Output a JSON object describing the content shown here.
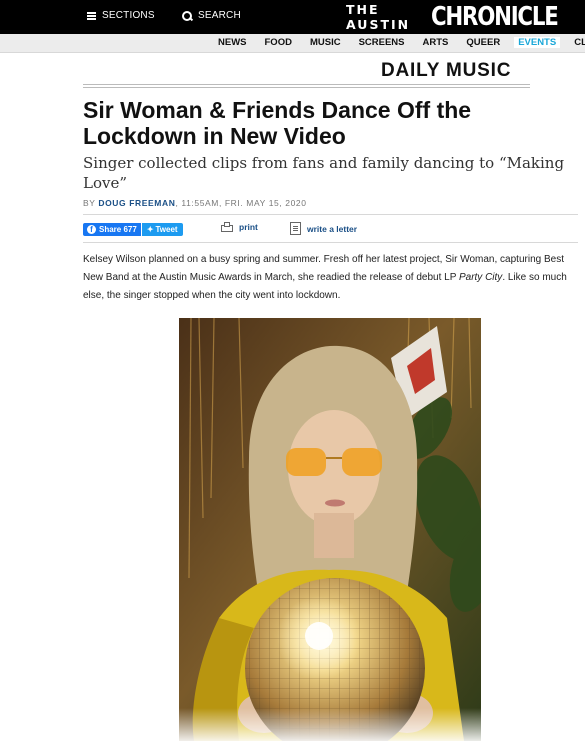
{
  "header": {
    "sections_label": "SECTIONS",
    "search_label": "SEARCH",
    "logo_the": "THE AUSTIN",
    "logo_chronicle": "CHRONICLE"
  },
  "nav": {
    "items": [
      "NEWS",
      "FOOD",
      "MUSIC",
      "SCREENS",
      "ARTS",
      "QUEER",
      "EVENTS",
      "CLASS"
    ],
    "active": "EVENTS",
    "active_color": "#1aa7d8"
  },
  "article": {
    "section": "DAILY MUSIC",
    "headline": "Sir Woman & Friends Dance Off the Lockdown in New Video",
    "dek": "Singer collected clips from fans and family dancing to “Making Love”",
    "byline_prefix": "BY ",
    "author": "DOUG FREEMAN",
    "timestamp": ", 11:55AM, FRI. MAY 15, 2020",
    "fb_share_label": "Share 677",
    "tweet_label": "Tweet",
    "print_label": "print",
    "letter_label": "write a letter",
    "body_part1": "Kelsey Wilson planned on a busy spring and summer. Fresh off her latest project, Sir Woman, capturing Best New Band at the Austin Music Awards in March, she readied the release of debut LP ",
    "body_italic": "Party City",
    "body_part2": ". Like so much else, the singer stopped when the city went into lockdown."
  },
  "colors": {
    "link": "#1a4f86",
    "facebook": "#1877f2",
    "twitter": "#1d9bf0"
  }
}
